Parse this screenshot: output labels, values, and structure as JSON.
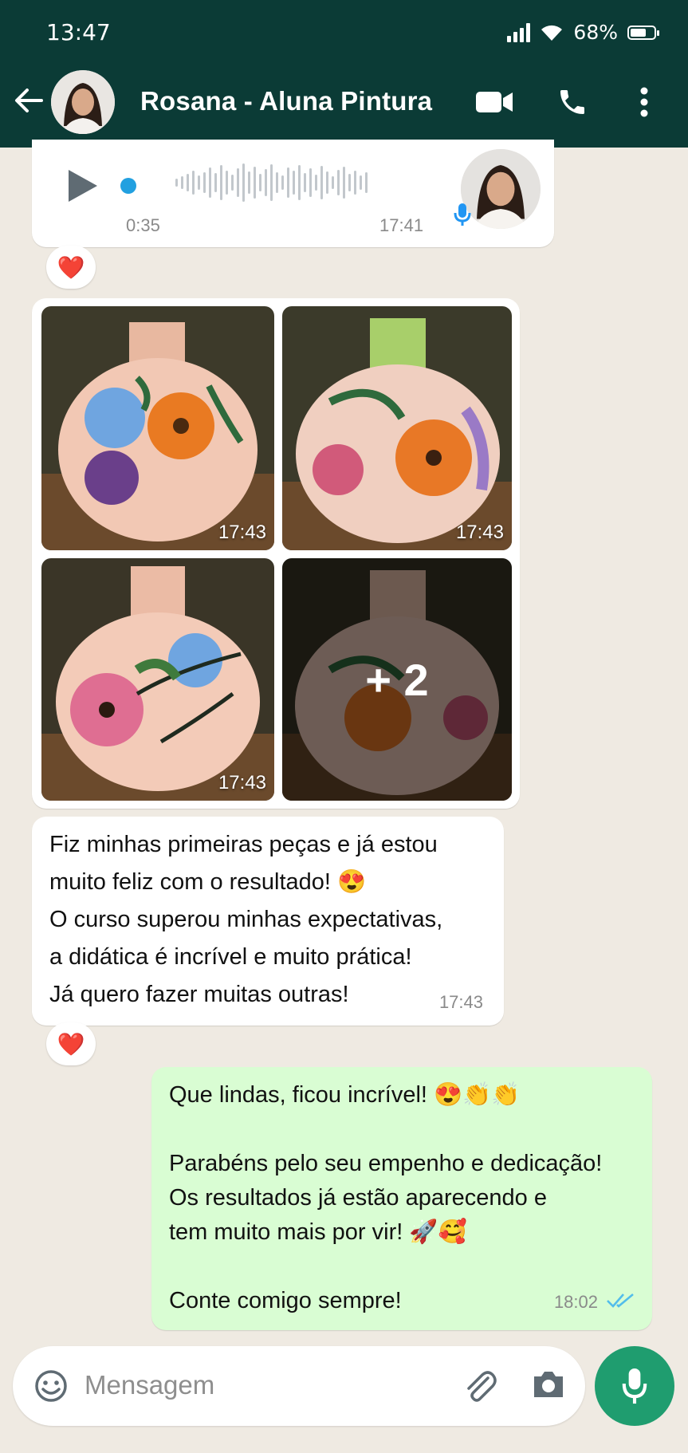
{
  "status_bar": {
    "time": "13:47",
    "battery": "68%",
    "battery_level": 0.68
  },
  "header": {
    "contact_name": "Rosana - Aluna Pintura"
  },
  "voice_message": {
    "duration": "0:35",
    "time": "17:41",
    "progress": 0.0
  },
  "reaction_emoji": "❤️",
  "photos": {
    "items": [
      {
        "time": "17:43"
      },
      {
        "time": "17:43"
      },
      {
        "time": "17:43"
      }
    ],
    "more_label": "+ 2"
  },
  "incoming_text": {
    "text": "Fiz minhas primeiras peças e já estou\nmuito feliz com o resultado! 😍\nO curso superou minhas expectativas,\na didática é incrível e muito prática!\nJá quero fazer muitas outras!",
    "time": "17:43"
  },
  "outgoing_text": {
    "text": "Que lindas, ficou incrível! 😍👏👏\n\nParabéns pelo seu empenho e dedicação!\nOs resultados já estão aparecendo e\ntem muito mais por vir! 🚀🥰\n\nConte comigo sempre!",
    "time": "18:02",
    "status": "read"
  },
  "composer": {
    "placeholder": "Mensagem"
  },
  "colors": {
    "header": "#0b3b36",
    "outgoing_bubble": "#d9fdd3",
    "mic_button": "#1f9d6f",
    "read_ticks": "#53bdeb"
  }
}
